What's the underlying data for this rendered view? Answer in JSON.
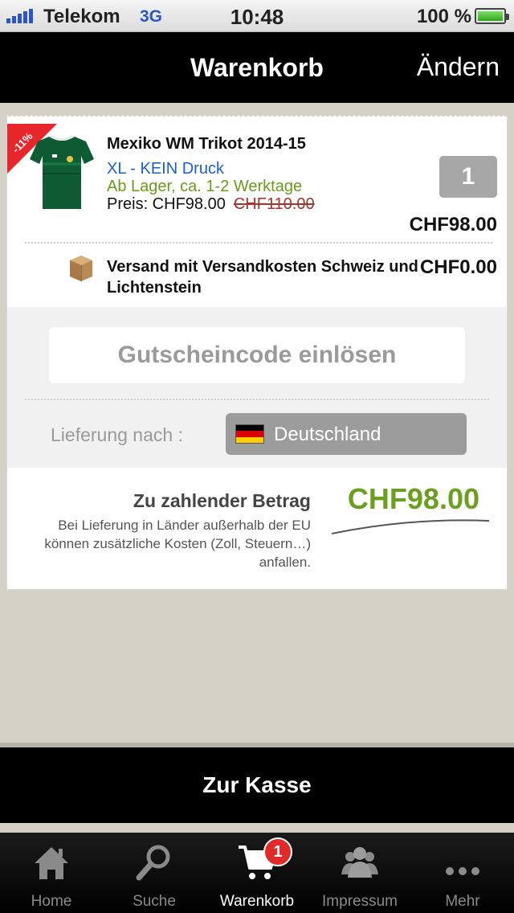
{
  "status_bar": {
    "carrier": "Telekom",
    "network": "3G",
    "time": "10:48",
    "battery": "100 %"
  },
  "nav": {
    "title": "Warenkorb",
    "edit_label": "Ändern"
  },
  "cart_item": {
    "discount_badge": "-11%",
    "title": "Mexiko WM Trikot 2014-15",
    "variant": "XL - KEIN Druck",
    "availability": "Ab Lager, ca. 1-2 Werktage",
    "price_label": "Preis: CHF98.00",
    "old_price": "CHF110.00",
    "quantity": "1",
    "line_total": "CHF98.00"
  },
  "shipping": {
    "label": "Versand mit Versandkosten Schweiz und Lichtenstein",
    "price": "CHF0.00"
  },
  "voucher": {
    "label": "Gutscheincode einlösen"
  },
  "delivery": {
    "label": "Lieferung nach :",
    "country": "Deutschland"
  },
  "totals": {
    "label": "Zu zahlender Betrag",
    "note": "Bei Lieferung in Länder außerhalb der EU können zusätzliche Kosten (Zoll, Steuern…) anfallen.",
    "amount": "CHF98.00"
  },
  "checkout": {
    "label": "Zur Kasse"
  },
  "tabs": [
    {
      "label": "Home",
      "icon": "home-icon"
    },
    {
      "label": "Suche",
      "icon": "search-icon"
    },
    {
      "label": "Warenkorb",
      "icon": "cart-icon",
      "badge": "1"
    },
    {
      "label": "Impressum",
      "icon": "people-icon"
    },
    {
      "label": "Mehr",
      "icon": "more-icon"
    }
  ],
  "colors": {
    "accent_green": "#6d9f1e",
    "link_blue": "#1e5fc9",
    "badge_red": "#e12a2a"
  }
}
